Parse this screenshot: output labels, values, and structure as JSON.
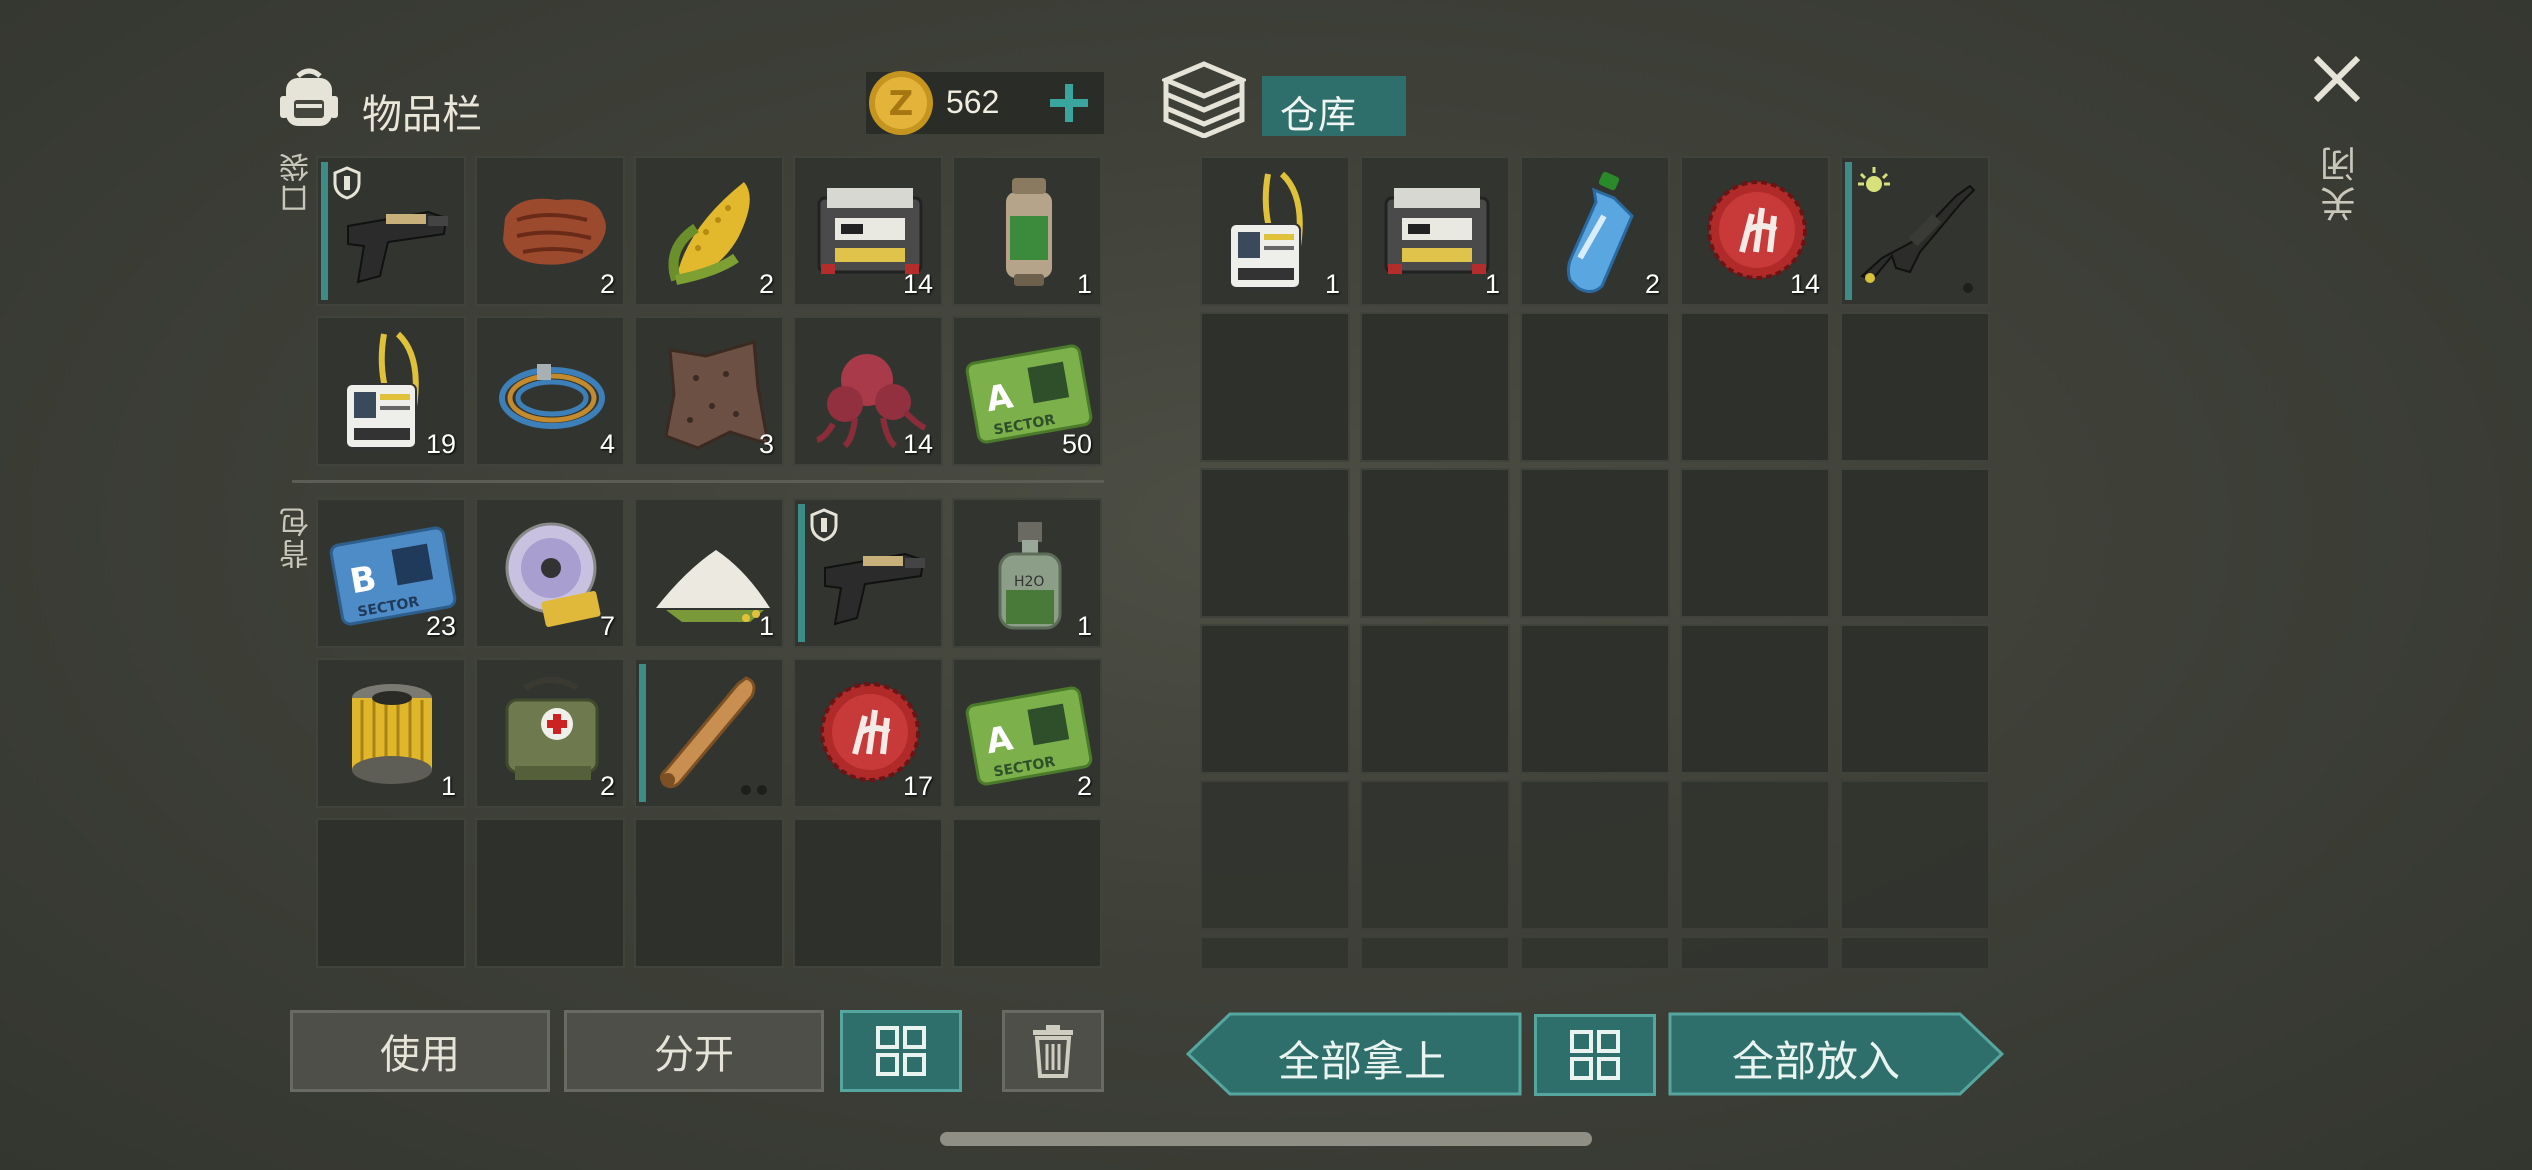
{
  "inventory": {
    "title": "物品栏",
    "coins": "562",
    "section_pocket": "口袋",
    "section_backpack": "背包",
    "pocket": [
      {
        "icon": "pistol-icon",
        "qty": "",
        "equip": true,
        "shield": true
      },
      {
        "icon": "steak-icon",
        "qty": "2"
      },
      {
        "icon": "corn-icon",
        "qty": "2"
      },
      {
        "icon": "battery-device-icon",
        "qty": "14"
      },
      {
        "icon": "canister-icon",
        "qty": "1"
      },
      {
        "icon": "id-badge-icon",
        "qty": "19"
      },
      {
        "icon": "cable-coil-icon",
        "qty": "4"
      },
      {
        "icon": "animal-hide-icon",
        "qty": "3"
      },
      {
        "icon": "mushroom-flesh-icon",
        "qty": "14"
      },
      {
        "icon": "sector-a-card-icon",
        "qty": "50"
      }
    ],
    "backpack": [
      {
        "icon": "sector-b-card-icon",
        "qty": "23"
      },
      {
        "icon": "disc-icon",
        "qty": "7"
      },
      {
        "icon": "flour-pile-icon",
        "qty": "1"
      },
      {
        "icon": "pistol-icon",
        "qty": "",
        "equip": true,
        "shield": true
      },
      {
        "icon": "bottle-icon",
        "qty": "1"
      },
      {
        "icon": "air-filter-icon",
        "qty": "1"
      },
      {
        "icon": "medkit-bag-icon",
        "qty": "2"
      },
      {
        "icon": "baseball-bat-icon",
        "qty": "",
        "equip": true,
        "durability": 2
      },
      {
        "icon": "bottle-cap-icon",
        "qty": "17"
      },
      {
        "icon": "sector-a-card-icon",
        "qty": "2"
      },
      {
        "icon": "",
        "qty": ""
      },
      {
        "icon": "",
        "qty": ""
      },
      {
        "icon": "",
        "qty": ""
      },
      {
        "icon": "",
        "qty": ""
      },
      {
        "icon": "",
        "qty": ""
      }
    ]
  },
  "storage": {
    "title": "仓库",
    "items": [
      {
        "icon": "id-badge-icon",
        "qty": "1"
      },
      {
        "icon": "battery-device-icon",
        "qty": "1"
      },
      {
        "icon": "water-bottle-icon",
        "qty": "2"
      },
      {
        "icon": "bottle-cap-icon",
        "qty": "14"
      },
      {
        "icon": "rifle-icon",
        "qty": "",
        "equip": true,
        "light": true,
        "durability": 1
      }
    ]
  },
  "close_label": "关闭",
  "buttons": {
    "use": "使用",
    "split": "分开",
    "take_all": "全部拿上",
    "put_all": "全部放入"
  },
  "colors": {
    "accent": "#2f6f6b",
    "accent_border": "#56a6a0",
    "slot_bg": "#2d302b"
  }
}
